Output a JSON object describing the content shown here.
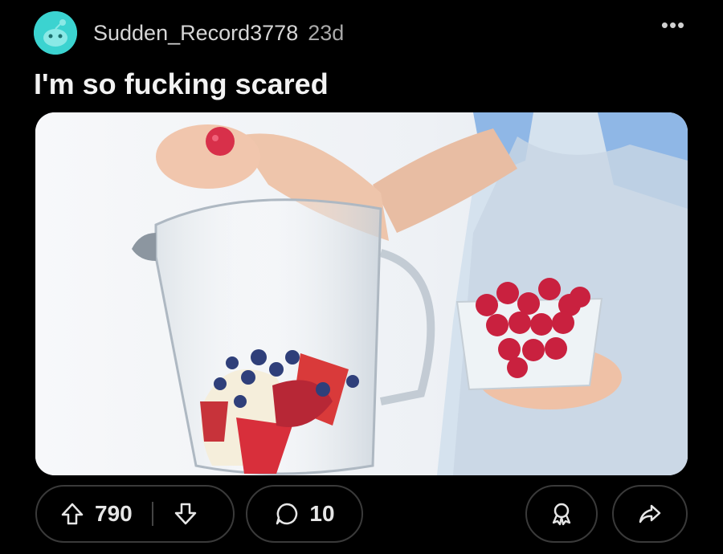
{
  "post": {
    "author": "Sudden_Record3778",
    "time": "23d",
    "title": "I'm so fucking scared"
  },
  "header": {
    "more_label": "•••"
  },
  "image": {
    "subject": "glass-blender-with-berries",
    "colors": {
      "avatar": "#3bd3d0",
      "background": "#000000"
    }
  },
  "actions": {
    "upvotes": "790",
    "comments": "10",
    "icons": [
      "upvote-icon",
      "downvote-icon",
      "comment-icon",
      "award-icon",
      "share-icon"
    ]
  }
}
